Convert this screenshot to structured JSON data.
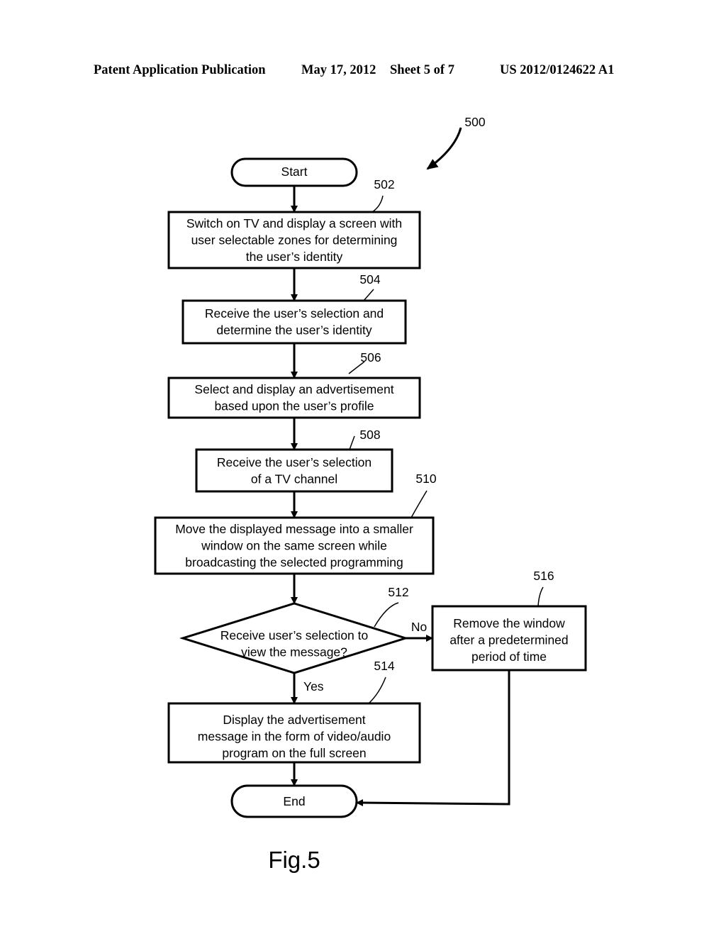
{
  "header": {
    "publication_type": "Patent Application Publication",
    "date": "May 17, 2012",
    "sheet": "Sheet 5 of 7",
    "publication_number": "US 2012/0124622 A1"
  },
  "figure": {
    "label": "Fig.5",
    "reference": "500",
    "nodes": [
      {
        "id": "start",
        "type": "terminal",
        "lines": [
          "Start"
        ]
      },
      {
        "id": "502",
        "type": "process",
        "ref": "502",
        "lines": [
          "Switch on TV and display a screen with",
          "user selectable zones for determining",
          "the user’s identity"
        ]
      },
      {
        "id": "504",
        "type": "process",
        "ref": "504",
        "lines": [
          "Receive the user’s selection and",
          "determine the user’s identity"
        ]
      },
      {
        "id": "506",
        "type": "process",
        "ref": "506",
        "lines": [
          "Select and display an advertisement",
          "based upon the user’s profile"
        ]
      },
      {
        "id": "508",
        "type": "process",
        "ref": "508",
        "lines": [
          "Receive the user’s selection",
          "of a TV channel"
        ]
      },
      {
        "id": "510",
        "type": "process",
        "ref": "510",
        "lines": [
          "Move the displayed message into a smaller",
          "window on the same screen while",
          "broadcasting the selected programming"
        ]
      },
      {
        "id": "512",
        "type": "decision",
        "ref": "512",
        "lines": [
          "Receive user’s selection to",
          "view the message?"
        ]
      },
      {
        "id": "514",
        "type": "process",
        "ref": "514",
        "lines": [
          "Display the advertisement",
          "message in the form of video/audio",
          "program on the full screen"
        ]
      },
      {
        "id": "516",
        "type": "process",
        "ref": "516",
        "lines": [
          "Remove the window",
          "after a predetermined",
          "period of time"
        ]
      },
      {
        "id": "end",
        "type": "terminal",
        "lines": [
          "End"
        ]
      }
    ],
    "edges": [
      {
        "from": "start",
        "to": "502",
        "label": ""
      },
      {
        "from": "502",
        "to": "504",
        "label": ""
      },
      {
        "from": "504",
        "to": "506",
        "label": ""
      },
      {
        "from": "506",
        "to": "508",
        "label": ""
      },
      {
        "from": "508",
        "to": "510",
        "label": ""
      },
      {
        "from": "510",
        "to": "512",
        "label": ""
      },
      {
        "from": "512",
        "to": "514",
        "label": "Yes"
      },
      {
        "from": "512",
        "to": "516",
        "label": "No"
      },
      {
        "from": "514",
        "to": "end",
        "label": ""
      },
      {
        "from": "516",
        "to": "end",
        "label": ""
      }
    ]
  }
}
